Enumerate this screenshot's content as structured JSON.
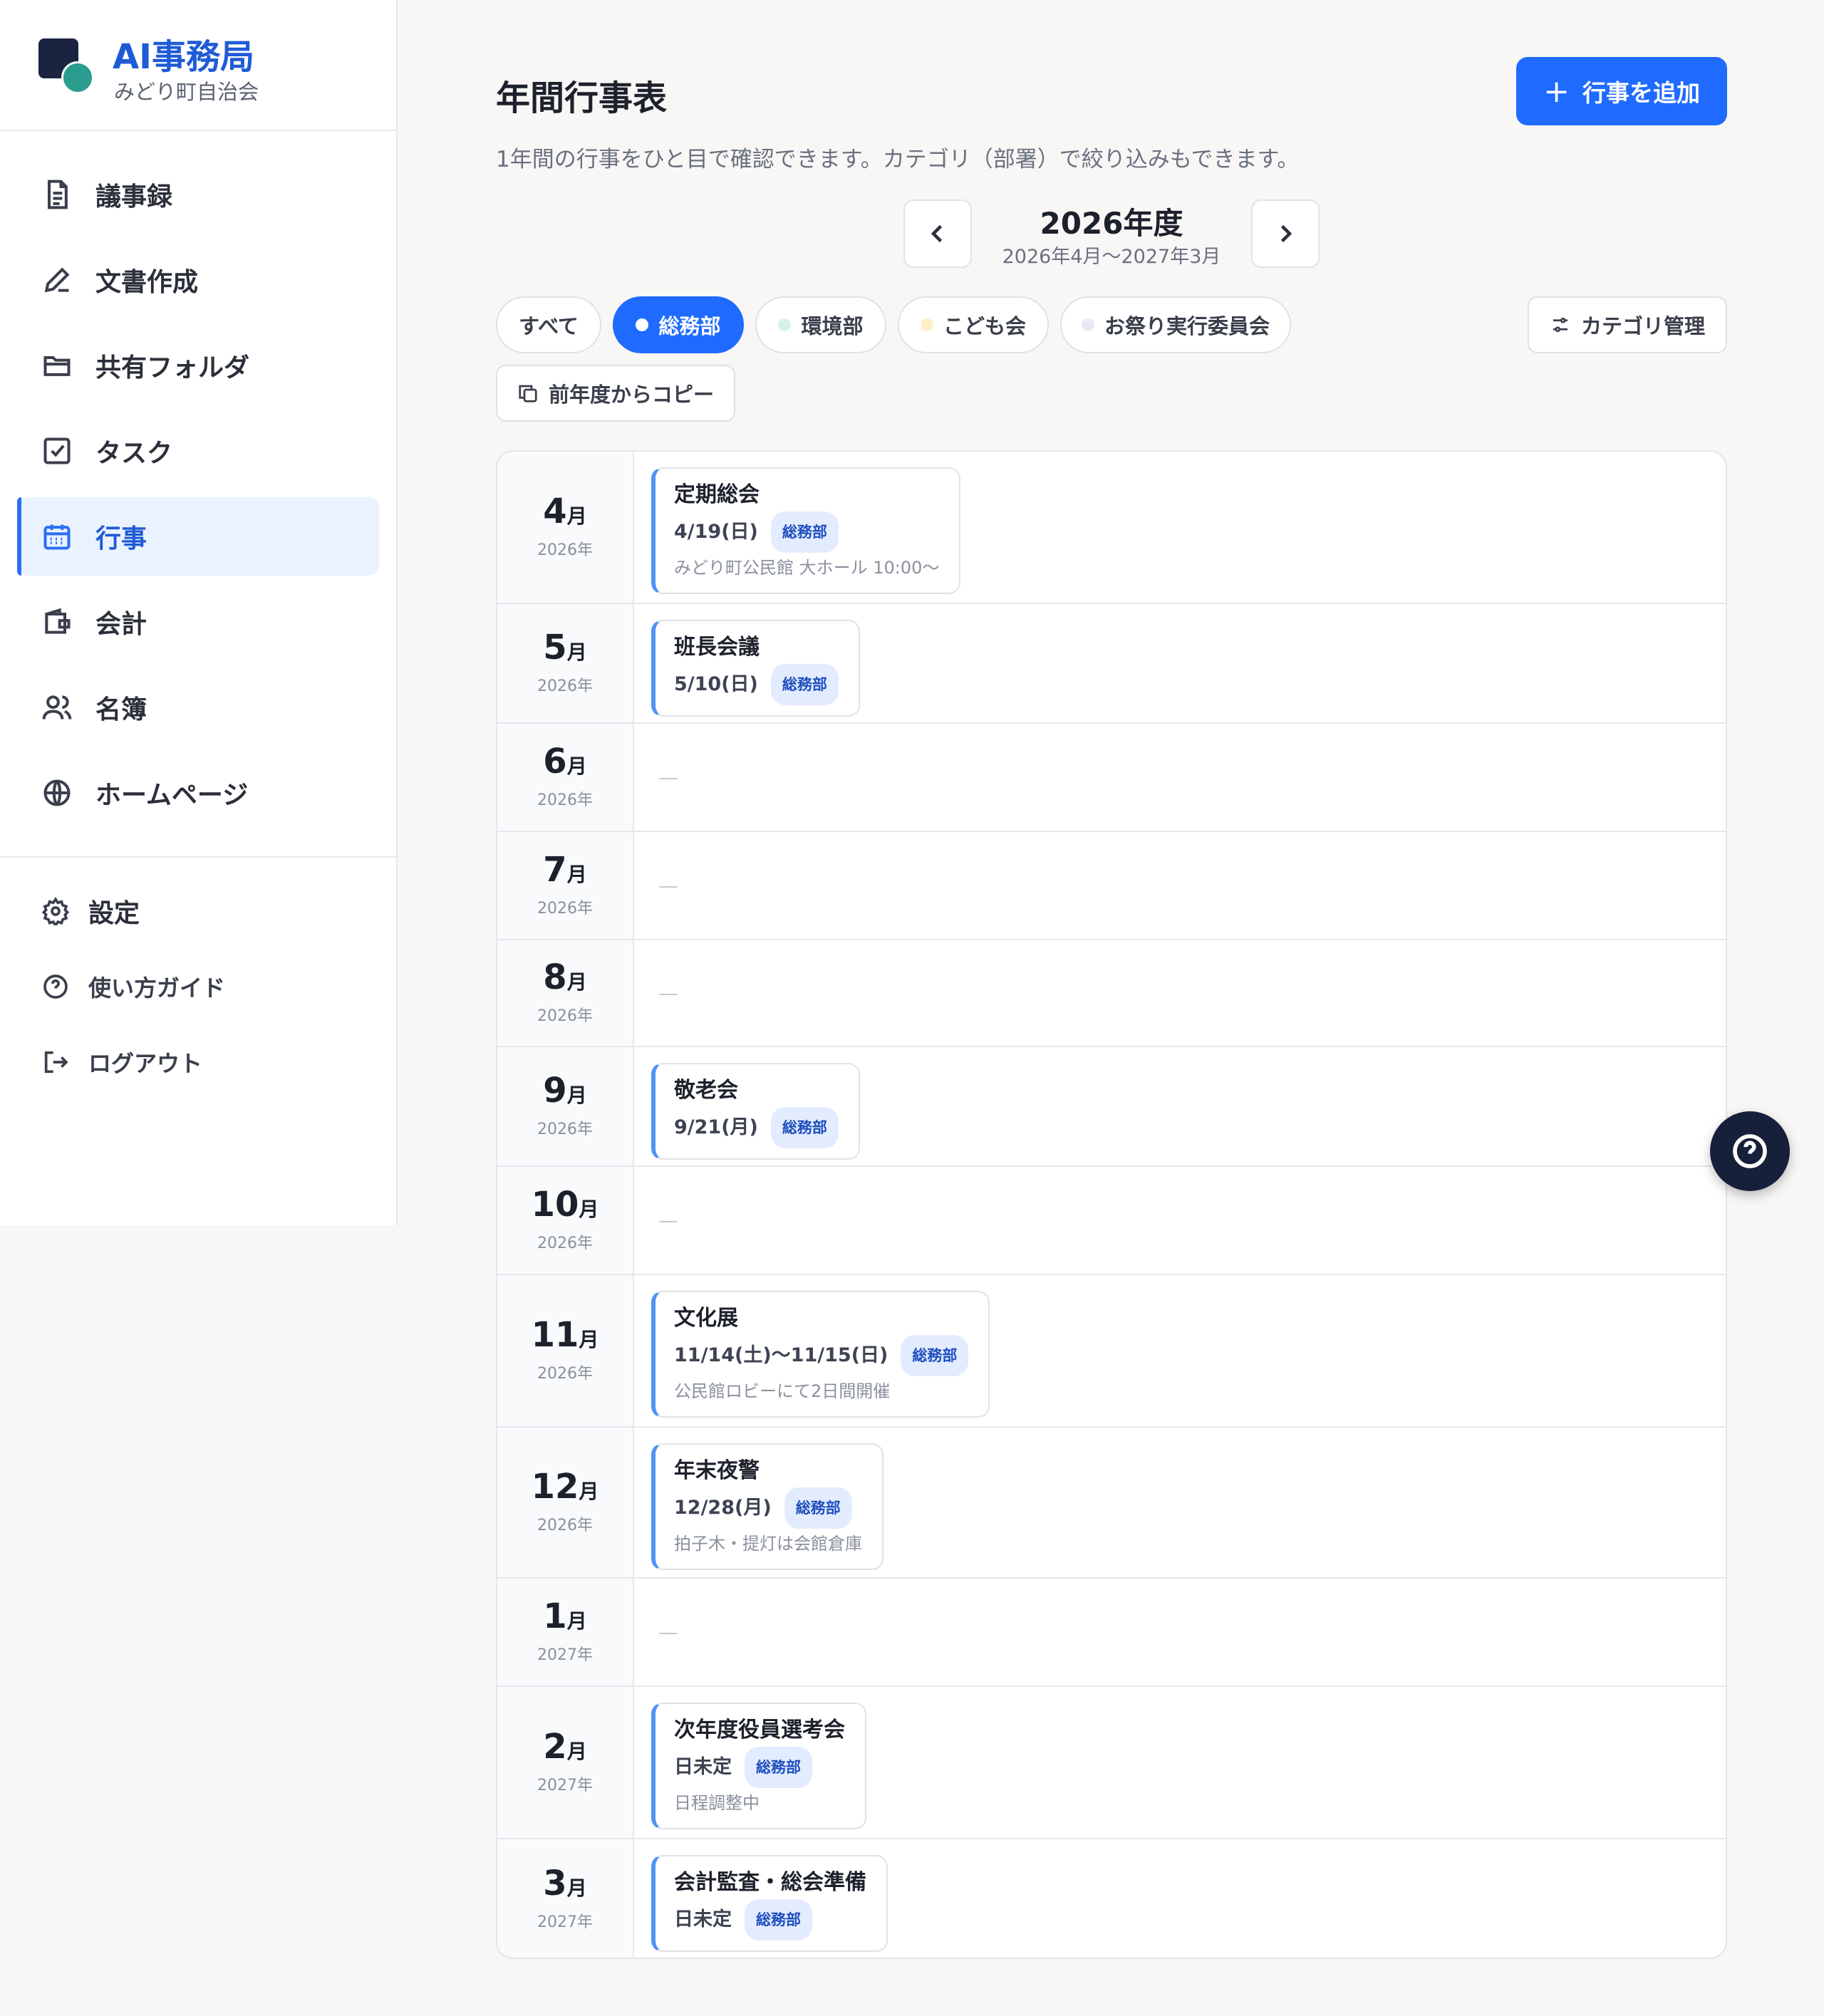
{
  "brand": {
    "title": "AI事務局",
    "subtitle": "みどり町自治会"
  },
  "sidebar": {
    "items": [
      {
        "label": "議事録",
        "icon": "document-icon"
      },
      {
        "label": "文書作成",
        "icon": "pen-icon"
      },
      {
        "label": "共有フォルダ",
        "icon": "folder-icon"
      },
      {
        "label": "タスク",
        "icon": "checkbox-icon"
      },
      {
        "label": "行事",
        "icon": "calendar-icon",
        "active": true
      },
      {
        "label": "会計",
        "icon": "wallet-icon"
      },
      {
        "label": "名簿",
        "icon": "users-icon"
      },
      {
        "label": "ホームページ",
        "icon": "globe-icon"
      }
    ],
    "bottom": [
      {
        "label": "設定",
        "icon": "gear-icon"
      },
      {
        "label": "使い方ガイド",
        "icon": "help-circle-icon"
      },
      {
        "label": "ログアウト",
        "icon": "logout-icon"
      }
    ]
  },
  "header": {
    "title": "年間行事表",
    "description": "1年間の行事をひと目で確認できます。カテゴリ（部署）で絞り込みもできます。",
    "add_button": "行事を追加"
  },
  "year": {
    "title": "2026年度",
    "range": "2026年4月〜2027年3月"
  },
  "filters": [
    {
      "label": "すべて",
      "active": false,
      "dot": null
    },
    {
      "label": "総務部",
      "active": true,
      "dot": "#ffffff"
    },
    {
      "label": "環境部",
      "active": false,
      "dot": "#d8f3e4"
    },
    {
      "label": "こども会",
      "active": false,
      "dot": "#fdf0c8"
    },
    {
      "label": "お祭り実行委員会",
      "active": false,
      "dot": "#ece6fb"
    }
  ],
  "category_manage": "カテゴリ管理",
  "copy_button": "前年度からコピー",
  "empty_marker": "—",
  "month_suffix": "月",
  "months": [
    {
      "month": "4",
      "year": "2026年",
      "events": [
        {
          "title": "定期総会",
          "date": "4/19(日)",
          "tag": "総務部",
          "note": "みどり町公民館 大ホール 10:00〜"
        }
      ]
    },
    {
      "month": "5",
      "year": "2026年",
      "events": [
        {
          "title": "班長会議",
          "date": "5/10(日)",
          "tag": "総務部",
          "note": ""
        }
      ]
    },
    {
      "month": "6",
      "year": "2026年",
      "events": []
    },
    {
      "month": "7",
      "year": "2026年",
      "events": []
    },
    {
      "month": "8",
      "year": "2026年",
      "events": []
    },
    {
      "month": "9",
      "year": "2026年",
      "events": [
        {
          "title": "敬老会",
          "date": "9/21(月)",
          "tag": "総務部",
          "note": ""
        }
      ]
    },
    {
      "month": "10",
      "year": "2026年",
      "events": []
    },
    {
      "month": "11",
      "year": "2026年",
      "events": [
        {
          "title": "文化展",
          "date": "11/14(土)〜11/15(日)",
          "tag": "総務部",
          "note": "公民館ロビーにて2日間開催"
        }
      ]
    },
    {
      "month": "12",
      "year": "2026年",
      "events": [
        {
          "title": "年末夜警",
          "date": "12/28(月)",
          "tag": "総務部",
          "note": "拍子木・提灯は会館倉庫"
        }
      ]
    },
    {
      "month": "1",
      "year": "2027年",
      "events": []
    },
    {
      "month": "2",
      "year": "2027年",
      "events": [
        {
          "title": "次年度役員選考会",
          "date": "日未定",
          "tag": "総務部",
          "note": "日程調整中"
        }
      ]
    },
    {
      "month": "3",
      "year": "2027年",
      "events": [
        {
          "title": "会計監査・総会準備",
          "date": "日未定",
          "tag": "総務部",
          "note": ""
        }
      ]
    }
  ]
}
